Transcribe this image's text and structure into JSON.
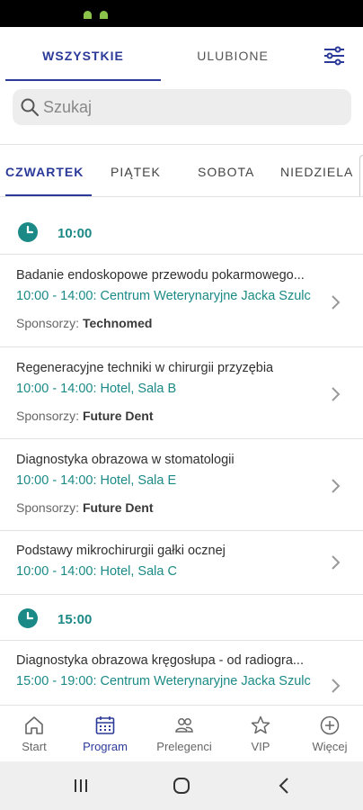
{
  "top_tabs": {
    "all_label": "WSZYSTKIE",
    "favorites_label": "ULUBIONE"
  },
  "search": {
    "placeholder": "Szukaj"
  },
  "day_tabs": [
    {
      "label": "CZWARTEK",
      "active": true
    },
    {
      "label": "PIĄTEK",
      "active": false
    },
    {
      "label": "SOBOTA",
      "active": false
    },
    {
      "label": "NIEDZIELA",
      "active": false
    }
  ],
  "groups": [
    {
      "time": "10:00",
      "sessions": [
        {
          "title": "Badanie endoskopowe przewodu pokarmowego...",
          "place": "10:00 - 14:00: Centrum Weterynaryjne Jacka Szulc",
          "sponsor_label": "Sponsorzy:",
          "sponsor": "Technomed"
        },
        {
          "title": "Regeneracyjne techniki w chirurgii przyzębia",
          "place": "10:00 - 14:00: Hotel, Sala B",
          "sponsor_label": "Sponsorzy:",
          "sponsor": "Future Dent"
        },
        {
          "title": "Diagnostyka obrazowa w stomatologii",
          "place": "10:00 - 14:00: Hotel, Sala E",
          "sponsor_label": "Sponsorzy:",
          "sponsor": "Future Dent"
        },
        {
          "title": "Podstawy mikrochirurgii gałki ocznej",
          "place": "10:00 - 14:00: Hotel, Sala C",
          "sponsor_label": "",
          "sponsor": ""
        }
      ]
    },
    {
      "time": "15:00",
      "sessions": [
        {
          "title": "Diagnostyka obrazowa kręgosłupa - od radiogra...",
          "place": "15:00 - 19:00: Centrum Weterynaryjne Jacka Szulc",
          "sponsor_label": "",
          "sponsor": ""
        }
      ]
    }
  ],
  "bottom_nav": [
    {
      "label": "Start",
      "icon": "home-icon",
      "active": false
    },
    {
      "label": "Program",
      "icon": "calendar-icon",
      "active": true
    },
    {
      "label": "Prelegenci",
      "icon": "people-icon",
      "active": false
    },
    {
      "label": "VIP",
      "icon": "star-icon",
      "active": false
    },
    {
      "label": "Więcej",
      "icon": "plus-circle-icon",
      "active": false
    }
  ],
  "colors": {
    "primary": "#2b3a99",
    "teal": "#1b8a86",
    "search_bg": "#ededed"
  }
}
